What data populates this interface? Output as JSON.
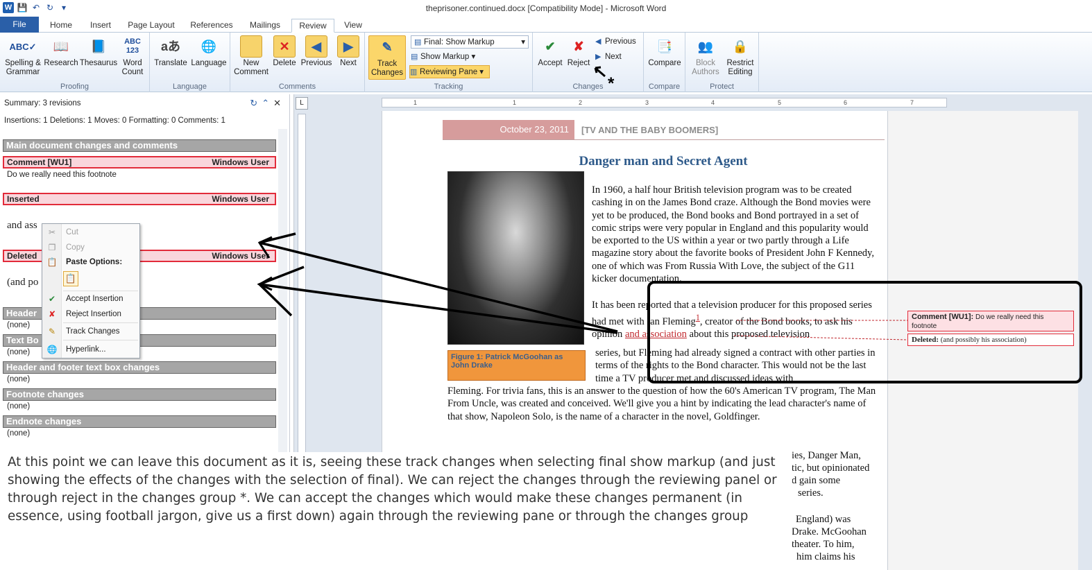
{
  "title_bar": {
    "title": "theprisoner.continued.docx [Compatibility Mode] - Microsoft Word",
    "logo": "W"
  },
  "tabs": [
    "File",
    "Home",
    "Insert",
    "Page Layout",
    "References",
    "Mailings",
    "Review",
    "View"
  ],
  "active_tab": "Review",
  "ribbon": {
    "proofing": {
      "label": "Proofing",
      "spelling": "Spelling &\nGrammar",
      "research": "Research",
      "thesaurus": "Thesaurus",
      "word_count": "Word\nCount"
    },
    "language": {
      "label": "Language",
      "translate": "Translate",
      "language": "Language"
    },
    "comments": {
      "label": "Comments",
      "new_comment": "New\nComment",
      "delete": "Delete",
      "previous": "Previous",
      "next": "Next"
    },
    "tracking": {
      "label": "Tracking",
      "track_changes": "Track\nChanges",
      "display_select": "Final: Show Markup",
      "show_markup": "Show Markup",
      "reviewing_pane": "Reviewing Pane"
    },
    "changes": {
      "label": "Changes",
      "accept": "Accept",
      "reject": "Reject",
      "previous": "Previous",
      "next": "Next"
    },
    "compare": {
      "label": "Compare",
      "compare": "Compare"
    },
    "protect": {
      "label": "Protect",
      "block_authors": "Block\nAuthors",
      "restrict_editing": "Restrict\nEditing"
    }
  },
  "pane": {
    "summary": "Summary: 3 revisions",
    "counts": "Insertions: 1  Deletions: 1  Moves: 0  Formatting: 0  Comments: 1",
    "main_section": "Main document changes and comments",
    "comment_head": "Comment [WU1]",
    "comment_author": "Windows User",
    "comment_text": "Do we really need this footnote",
    "inserted_head": "Inserted",
    "inserted_author": "Windows User",
    "inserted_text": "and ass",
    "deleted_head": "Deleted",
    "deleted_author": "Windows User",
    "deleted_text": "(and po",
    "header_section": "Header",
    "header_none": "(none)",
    "textbox_section": "Text Bo",
    "textbox_none": "(none)",
    "hf_textbox_section": "Header and footer text box changes",
    "hf_textbox_none": "(none)",
    "footnote_section": "Footnote changes",
    "footnote_none": "(none)",
    "endnote_section": "Endnote changes",
    "endnote_none": "(none)"
  },
  "context_menu": {
    "cut": "Cut",
    "copy": "Copy",
    "paste_options": "Paste Options:",
    "accept_insertion": "Accept Insertion",
    "reject_insertion": "Reject Insertion",
    "track_changes": "Track Changes",
    "hyperlink": "Hyperlink..."
  },
  "ruler_numbers": [
    "1",
    "1",
    "2",
    "3",
    "4",
    "5",
    "6",
    "7"
  ],
  "document": {
    "date": "October 23, 2011",
    "header_title": "[TV AND THE BABY BOOMERS]",
    "heading": "Danger man and Secret Agent",
    "caption": "Figure 1: Patrick McGoohan as John Drake",
    "para1": "In 1960, a half hour British television program was to be created cashing in on the James Bond craze. Although the Bond movies were yet to be produced, the Bond books and Bond portrayed in a set of comic strips were very popular in England and this popularity would be exported to the US within a year or two partly through a Life magazine story about the favorite books of President John F Kennedy, one of which was From Russia With Love, the subject of the G11 kicker documentation.",
    "para2_a": "It has been reported that a television producer for this proposed series had met with Ian Fleming",
    "para2_comment_ref": "1",
    "para2_b": ", creator of the Bond books, to ask his opinion",
    "para2_inserted": "and association",
    "para2_c": " about this proposed television",
    "para3": "series, but Fleming had already signed a contract with other parties in terms of the rights to the Bond character. This would not be the last time a TV producer met and discussed ideas with",
    "para4": "Fleming. For trivia fans, this is an answer to the question of how the 60's American TV program, The Man From Uncle, was created and conceived. We'll give you a hint by indicating the lead character's name of that show, Napoleon Solo, is the name of a character in the novel, Goldfinger.",
    "frag1": "ies, Danger Man,",
    "frag2": "tic, but opinionated",
    "frag3": "d gain some",
    "frag4": "series.",
    "frag5": "England) was",
    "frag6": "Drake. McGoohan",
    "frag7": "theater. To him,",
    "frag8": "him claims his"
  },
  "balloons": {
    "comment_label": "Comment [WU1]:",
    "comment_text": "Do we really need this footnote",
    "deleted_label": "Deleted:",
    "deleted_text": "(and possibly his association)"
  },
  "annotation": {
    "asterisk": "*",
    "text": "At this point we can leave this document as it is, seeing these track changes when selecting final show markup (and just showing the effects of the changes with the selection of final). We can reject the changes through the reviewing panel or through reject in the changes group *. We can accept the changes which would make these changes permanent (in essence, using football jargon, give us a first down) again through the reviewing pane or through the changes group"
  },
  "colors": {
    "file_tab": "#2a5fa8",
    "revision_border": "#e22b3a",
    "revision_fill": "#f9d6dc",
    "section_gray": "#a6a6a6",
    "heading_blue": "#2e5a8a",
    "insert_red": "#c0262c",
    "date_band": "#d69c9c",
    "caption_orange": "#f0963c",
    "highlight": "#fbd66a"
  }
}
